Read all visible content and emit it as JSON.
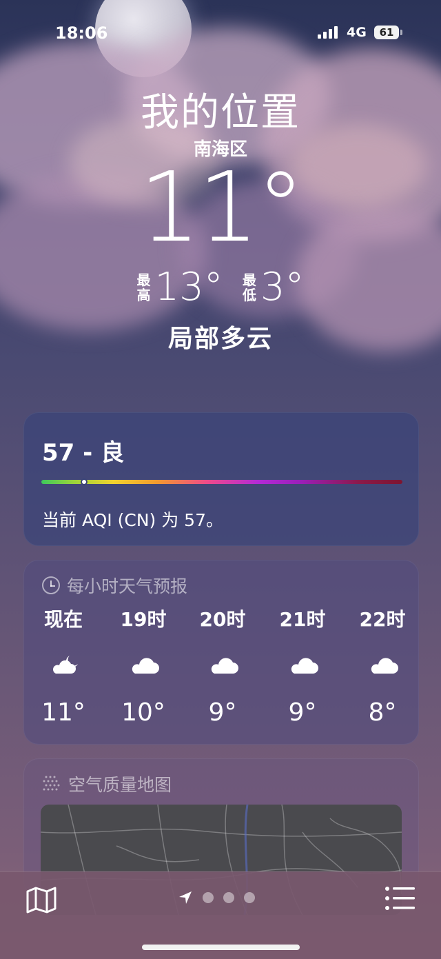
{
  "status_bar": {
    "time": "18:06",
    "network": "4G",
    "battery": "61"
  },
  "weather": {
    "location": "我的位置",
    "district": "南海区",
    "temperature": "11°",
    "high_label_1": "最",
    "high_label_2": "高",
    "high": "13°",
    "low_label_1": "最",
    "low_label_2": "低",
    "low": "3°",
    "condition": "局部多云"
  },
  "aqi": {
    "title": "57 - 良",
    "value": 57,
    "description": "当前 AQI (CN) 为 57。"
  },
  "hourly": {
    "header": "每小时天气预报",
    "items": [
      {
        "label": "现在",
        "icon": "cloud-moon-icon",
        "temp": "11°"
      },
      {
        "label": "19时",
        "icon": "cloud-icon",
        "temp": "10°"
      },
      {
        "label": "20时",
        "icon": "cloud-icon",
        "temp": "9°"
      },
      {
        "label": "21时",
        "icon": "cloud-icon",
        "temp": "9°"
      },
      {
        "label": "22时",
        "icon": "cloud-icon",
        "temp": "8°"
      }
    ]
  },
  "air_map": {
    "header": "空气质量地图"
  },
  "bottom_bar": {
    "page_count": 4,
    "current_page": 1
  }
}
